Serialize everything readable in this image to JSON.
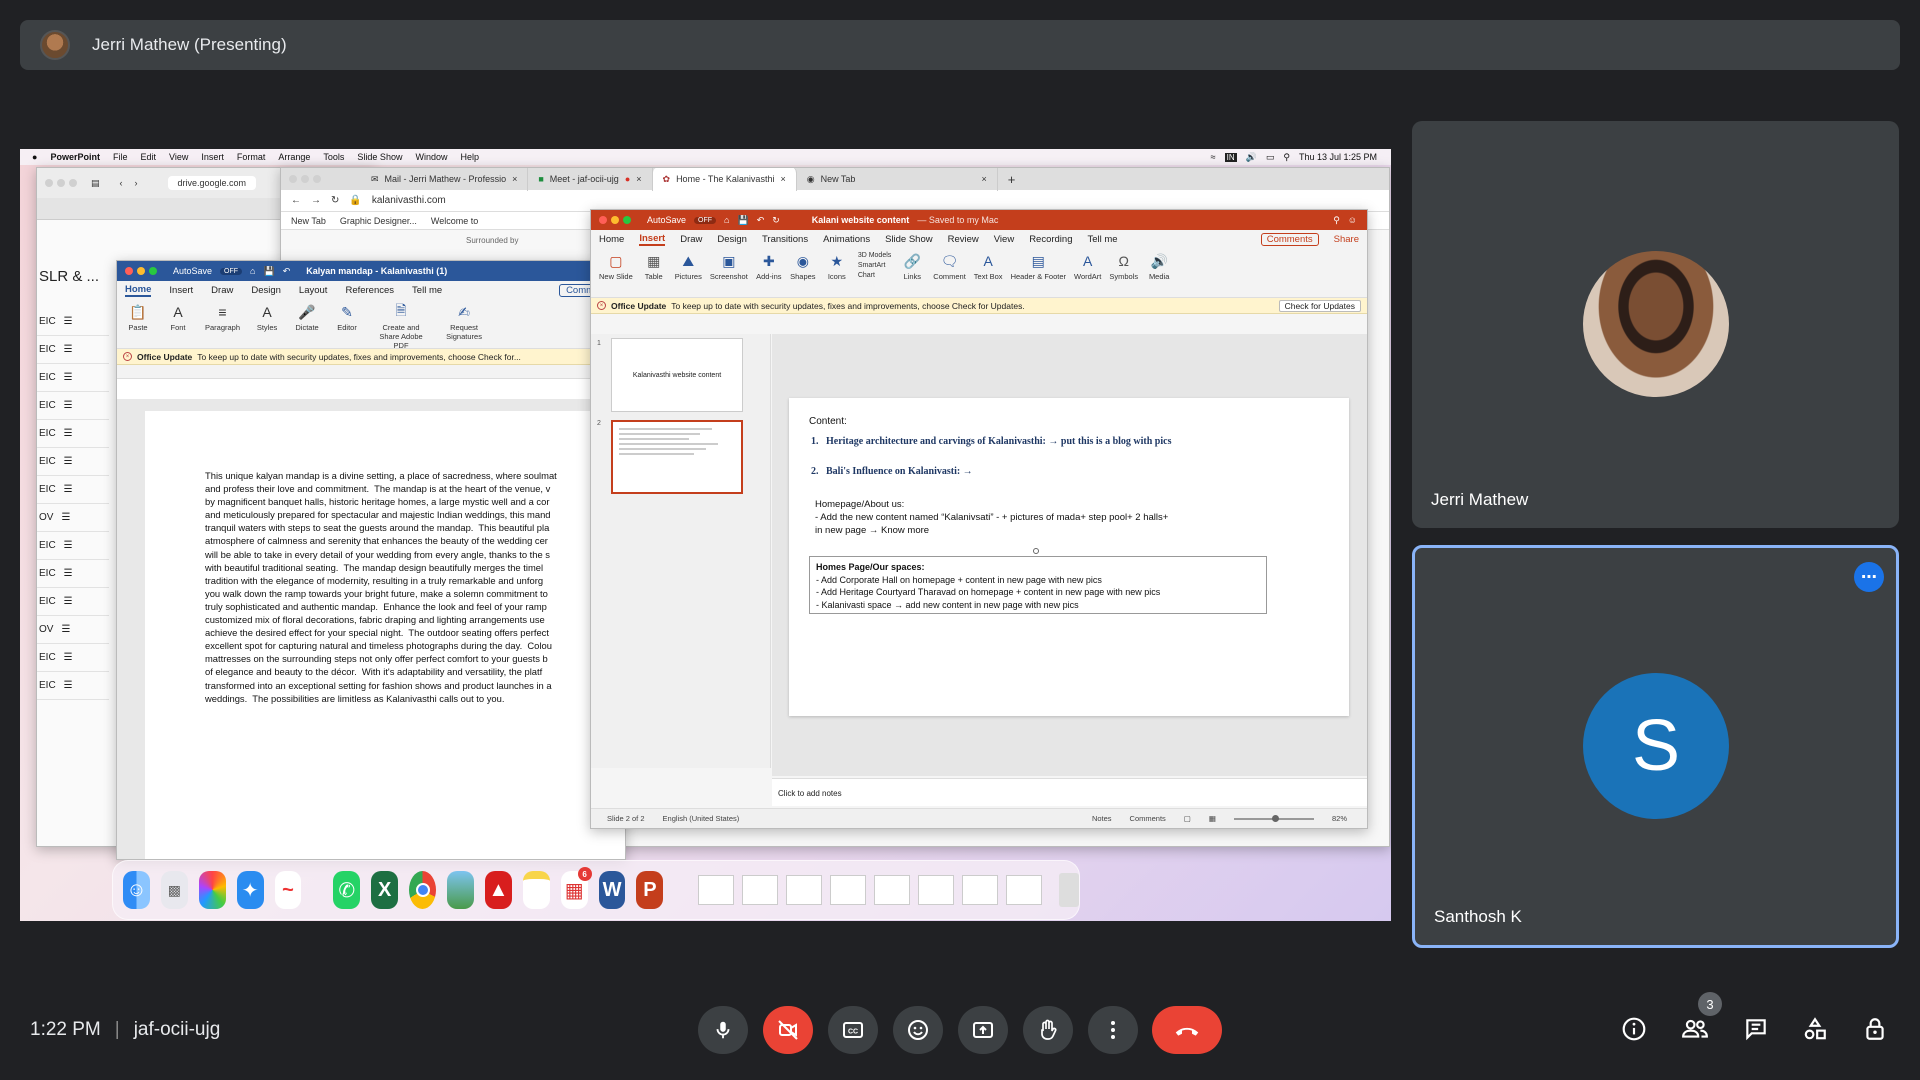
{
  "presenter_bar": {
    "title": "Jerri Mathew (Presenting)"
  },
  "mac_menu": {
    "apple": "",
    "app": "PowerPoint",
    "items": [
      "File",
      "Edit",
      "View",
      "Insert",
      "Format",
      "Arrange",
      "Tools",
      "Slide Show",
      "Window",
      "Help"
    ],
    "lang": "IN",
    "clock": "Thu 13 Jul  1:25 PM"
  },
  "chrome_back": {
    "url": "drive.google.com",
    "sidebar_heading": "SLR & ...",
    "rows": [
      "EIC",
      "EIC",
      "EIC",
      "EIC",
      "EIC",
      "EIC",
      "EIC",
      "OV",
      "EIC",
      "EIC",
      "EIC",
      "OV",
      "EIC",
      "EIC"
    ]
  },
  "chrome_front": {
    "tabs": [
      "Mail - Jerri Mathew - Professio",
      "Meet - jaf-ocii-ujg",
      "Home - The Kalanivasthi",
      "New Tab"
    ],
    "url": "kalanivasthi.com",
    "bookmarks": [
      "New Tab",
      "Graphic Designer...",
      "Welcome to"
    ],
    "snippet": "Surrounded by"
  },
  "word": {
    "autosave": "AutoSave",
    "autosave_state": "OFF",
    "title": "Kalyan mandap - Kalanivasthi (1)",
    "tabs": [
      "Home",
      "Insert",
      "Draw",
      "Design",
      "Layout",
      "References",
      "Tell me"
    ],
    "comments": "Comments",
    "ribbon": [
      "Paste",
      "Font",
      "Paragraph",
      "Styles",
      "Dictate",
      "Editor",
      "Create and Share Adobe PDF",
      "Request Signatures"
    ],
    "notice_title": "Office Update",
    "notice_text": "To keep up to date with security updates, fixes and improvements, choose Check for...",
    "body": [
      "This unique kalyan mandap is a divine setting, a place of sacredness, where soulmat",
      "and profess their love and commitment.  The mandap is at the heart of the venue, v",
      "by magnificent banquet halls, historic heritage homes, a large mystic well and a cor",
      "and meticulously prepared for spectacular and majestic Indian weddings, this mand",
      "tranquil waters with steps to seat the guests around the mandap.  This beautiful pla",
      "atmosphere of calmness and serenity that enhances the beauty of the wedding cer",
      "will be able to take in every detail of your wedding from every angle, thanks to the s",
      "with beautiful traditional seating.  The mandap design beautifully merges the timel",
      "tradition with the elegance of modernity, resulting in a truly remarkable and unforg",
      "you walk down the ramp towards your bright future, make a solemn commitment to",
      "truly sophisticated and authentic mandap.  Enhance the look and feel of your ramp",
      "customized mix of floral decorations, fabric draping and lighting arrangements use",
      "achieve the desired effect for your special night.  The outdoor seating offers perfect",
      "excellent spot for capturing natural and timeless photographs during the day.  Colou",
      "mattresses on the surrounding steps not only offer perfect comfort to your guests b",
      "of elegance and beauty to the décor.  With it's adaptability and versatility, the platf",
      "transformed into an exceptional setting for fashion shows and product launches in a",
      "weddings.  The possibilities are limitless as Kalanivasthi calls out to you."
    ]
  },
  "ppt": {
    "autosave": "AutoSave",
    "autosave_state": "OFF",
    "title": "Kalani website content",
    "title_suffix": "— Saved to my Mac",
    "tabs": [
      "Home",
      "Insert",
      "Draw",
      "Design",
      "Transitions",
      "Animations",
      "Slide Show",
      "Review",
      "View",
      "Recording",
      "Tell me"
    ],
    "comments": "Comments",
    "share": "Share",
    "ribbon": [
      "New Slide",
      "Table",
      "Pictures",
      "Screenshot",
      "Add-ins",
      "Shapes",
      "Icons",
      "3D Models",
      "SmartArt",
      "Chart",
      "Links",
      "Comment",
      "Text Box",
      "Header & Footer",
      "WordArt",
      "Symbols",
      "Media"
    ],
    "notice_title": "Office Update",
    "notice_text": "To keep up to date with security updates, fixes and improvements, choose Check for Updates.",
    "check_button": "Check for Updates",
    "thumb1": "Kalanivasthi website content",
    "slide": {
      "content_label": "Content:",
      "item1": "Heritage architecture and carvings of Kalanivasthi: → put this is a blog with pics",
      "item2": "Bali's Influence on Kalanivasti: →",
      "homepage_label": "Homepage/About us:",
      "homepage_line1": "-  Add the new content named “Kalanivsati” - + pictures of mada+ step pool+ 2 halls+",
      "homepage_line2": "in new page → Know more",
      "box_title": "Homes Page/Our spaces:",
      "box_line1": "-   Add Corporate Hall  on homepage + content in new page with new pics",
      "box_line2": "-   Add Heritage Courtyard Tharavad on homepage + content in new page with new pics",
      "box_line3": "-   Kalanivasti space → add new content  in new page with new pics"
    },
    "notes_placeholder": "Click to add notes",
    "status_slide": "Slide 2 of 2",
    "status_lang": "English (United States)",
    "status_notes": "Notes",
    "status_comments": "Comments",
    "zoom": "82%"
  },
  "dock": {
    "icons": [
      "finder",
      "launchpad",
      "photos",
      "safari",
      "freeform",
      "whatsapp",
      "excel",
      "chrome",
      "preview",
      "acrobat",
      "notes",
      "app-store",
      "word",
      "powerpoint"
    ],
    "badge": "6"
  },
  "participants": [
    {
      "name": "Jerri Mathew"
    },
    {
      "name": "Santhosh K",
      "initial": "S"
    }
  ],
  "meeting": {
    "time": "1:22 PM",
    "code": "jaf-ocii-ujg",
    "people_count": "3"
  },
  "colors": {
    "meet_bg": "#202124",
    "tile_bg": "#3c4043",
    "end_call": "#ea4335",
    "avatar_blue": "#1a73b8",
    "ppt_accent": "#c43e1c",
    "word_accent": "#2b579a",
    "active_speaker": "#8ab4f8"
  }
}
